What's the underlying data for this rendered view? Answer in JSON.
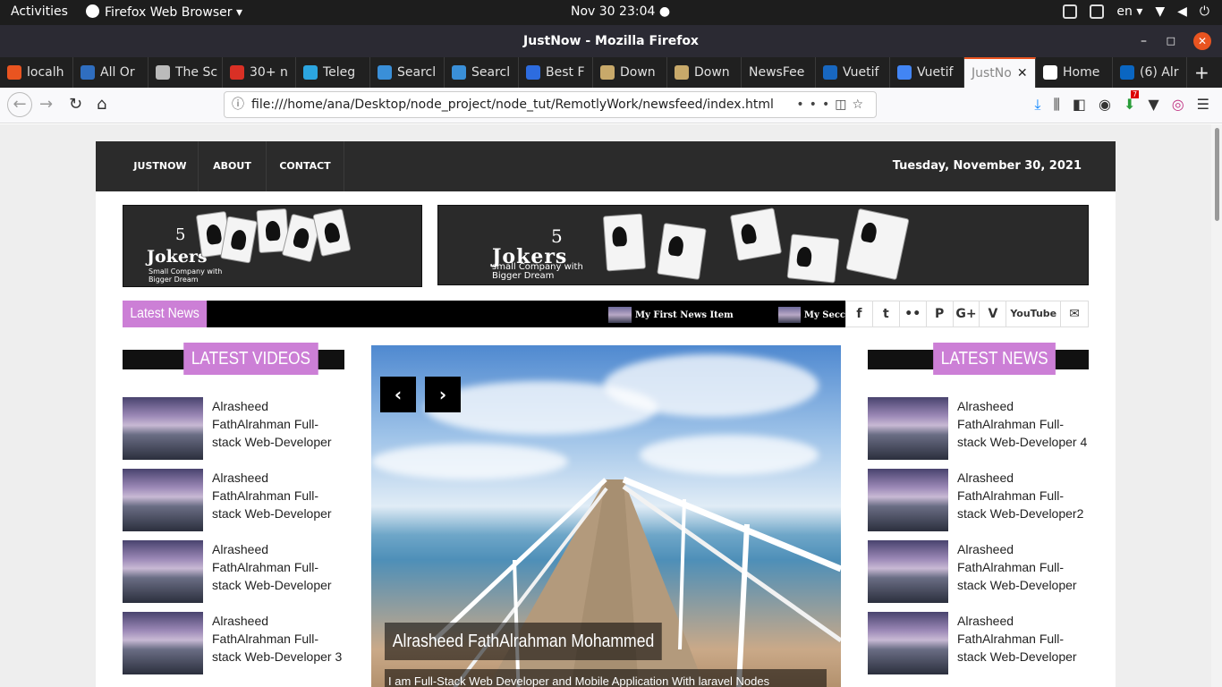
{
  "gnome": {
    "activities": "Activities",
    "app_menu": "Firefox Web Browser ▾",
    "clock": "Nov 30  23:04 ●",
    "lang": "en ▾"
  },
  "window": {
    "title": "JustNow - Mozilla Firefox"
  },
  "tabs": [
    {
      "label": "localh",
      "color": "#e95420"
    },
    {
      "label": "All Or",
      "color": "#2f6ec0"
    },
    {
      "label": "The Sc",
      "color": "#bbbbbb"
    },
    {
      "label": "30+ n",
      "color": "#d93025"
    },
    {
      "label": "Teleg",
      "color": "#2ca5e0"
    },
    {
      "label": "Searcl",
      "color": "#3a8fd8"
    },
    {
      "label": "Searcl",
      "color": "#3a8fd8"
    },
    {
      "label": "Best F",
      "color": "#2d6cdf"
    },
    {
      "label": "Down",
      "color": "#c8a96a"
    },
    {
      "label": "Down",
      "color": "#c8a96a"
    },
    {
      "label": "NewsFee",
      "color": ""
    },
    {
      "label": "Vuetif",
      "color": "#1867c0"
    },
    {
      "label": "Vuetif",
      "color": "#4285f4"
    },
    {
      "label": "JustNo",
      "color": "",
      "active": true
    },
    {
      "label": "Home",
      "color": "#ffffff"
    },
    {
      "label": "(6) Alr",
      "color": "#0a66c2"
    }
  ],
  "nav": {
    "url": "file:///home/ana/Desktop/node_project/node_tut/RemotlyWork/newsfeed/index.html",
    "badge": "7"
  },
  "site": {
    "menu": [
      "JUSTNOW",
      "ABOUT",
      "CONTACT"
    ],
    "date": "Tuesday, November 30, 2021",
    "banner": {
      "num": "5",
      "brand": "Jokers",
      "tagline_small": "Small Company with\nBigger Dream",
      "tagline_large": "small Company with\nBigger Dream"
    },
    "ticker": {
      "label": "Latest News",
      "items": [
        "My First News Item",
        "My Secc"
      ]
    },
    "social": [
      "f",
      "t",
      "••",
      "P",
      "G+",
      "V",
      "YouTube",
      "✉"
    ],
    "latest_videos": {
      "title": "LATEST VIDEOS",
      "items": [
        "Alrasheed FathAlrahman Full-stack Web-Developer",
        "Alrasheed FathAlrahman Full-stack Web-Developer",
        "Alrasheed FathAlrahman Full-stack Web-Developer",
        "Alrasheed FathAlrahman Full-stack Web-Developer 3"
      ]
    },
    "slider": {
      "prev": "‹",
      "next": "›",
      "title": "Alrasheed FathAlrahman Mohammed",
      "desc": "I am Full-Stack Web Developer and Mobile Application With laravel Nodes"
    },
    "latest_news": {
      "title": "LATEST NEWS",
      "items": [
        "Alrasheed FathAlrahman Full-stack Web-Developer 4",
        "Alrasheed FathAlrahman Full-stack Web-Developer2",
        "Alrasheed FathAlrahman Full-stack Web-Developer",
        "Alrasheed FathAlrahman Full-stack Web-Developer"
      ]
    }
  }
}
